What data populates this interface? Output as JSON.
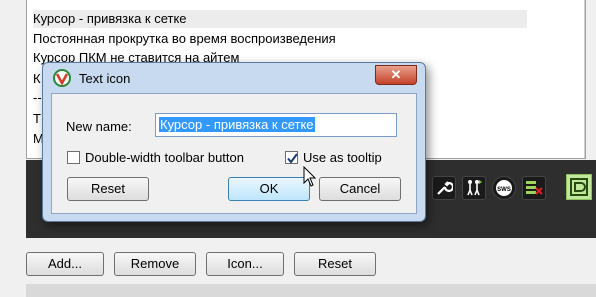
{
  "list": {
    "items": [
      "Курсор - привязка к сетке",
      "Постоянная прокрутка во время воспроизведения",
      "Курсор ПКМ не ставится на айтем",
      "К",
      "--",
      "Т",
      "М"
    ]
  },
  "bottom_buttons": {
    "add": "Add...",
    "remove": "Remove",
    "icon": "Icon...",
    "reset": "Reset"
  },
  "toolbar": {
    "sws_label": "SWS"
  },
  "dialog": {
    "title": "Text icon",
    "close_label": "✕",
    "new_name_label": "New name:",
    "new_name_value": "Курсор - привязка к сетке",
    "double_width_label": "Double-width toolbar button",
    "double_width_checked": false,
    "tooltip_label": "Use as tooltip",
    "tooltip_checked": true,
    "reset_label": "Reset",
    "ok_label": "OK",
    "cancel_label": "Cancel"
  },
  "colors": {
    "selection": "#3399ff",
    "toolbar_bg": "#2e2e2e",
    "dialog_frame": "#c8daf0",
    "close_red": "#c4412a"
  }
}
